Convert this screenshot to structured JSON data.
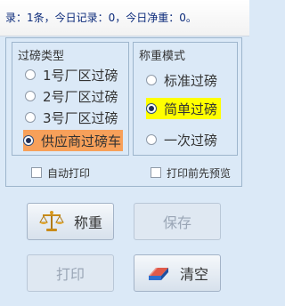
{
  "status_text": "录：1条，今日记录：0，今日净重：0。",
  "weigh_type": {
    "title": "过磅类型",
    "options": [
      {
        "label": "1号厂区过磅",
        "selected": false
      },
      {
        "label": "2号厂区过磅",
        "selected": false
      },
      {
        "label": "3号厂区过磅",
        "selected": false
      },
      {
        "label": "供应商过磅车",
        "selected": true
      }
    ]
  },
  "weigh_mode": {
    "title": "称重模式",
    "options": [
      {
        "label": "标准过磅",
        "selected": false
      },
      {
        "label": "简单过磅",
        "selected": true
      },
      {
        "label": "一次过磅",
        "selected": false
      }
    ]
  },
  "checks": {
    "auto_print": "自动打印",
    "preview_before_print": "打印前先预览"
  },
  "buttons": {
    "weigh": "称重",
    "save": "保存",
    "print": "打印",
    "clear": "清空"
  }
}
